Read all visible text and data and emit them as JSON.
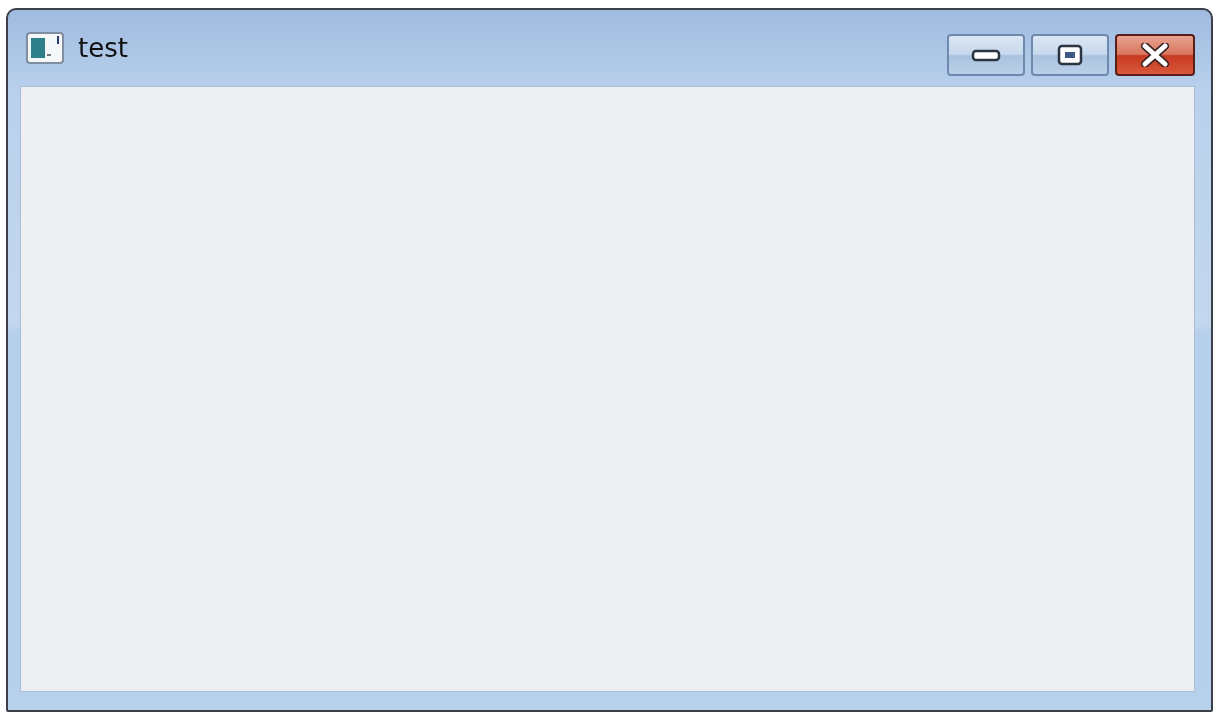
{
  "window": {
    "title": "test",
    "controls": [
      {
        "kind": "minimize"
      },
      {
        "kind": "maximize"
      },
      {
        "kind": "close"
      }
    ]
  }
}
